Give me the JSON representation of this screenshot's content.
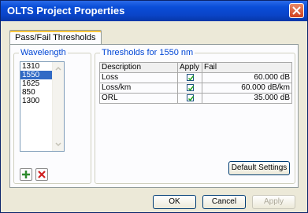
{
  "window": {
    "title": "OLTS Project Properties"
  },
  "tabs": [
    {
      "label": "Pass/Fail Thresholds"
    }
  ],
  "wavelength": {
    "group_title": "Wavelength",
    "items": [
      "1310",
      "1550",
      "1625",
      "850",
      "1300"
    ],
    "selected": "1550"
  },
  "thresholds": {
    "group_title": "Thresholds for 1550 nm",
    "columns": [
      "Description",
      "Apply",
      "Fail"
    ],
    "rows": [
      {
        "description": "Loss",
        "apply": true,
        "fail": "60.000 dB"
      },
      {
        "description": "Loss/km",
        "apply": true,
        "fail": "60.000 dB/km"
      },
      {
        "description": "ORL",
        "apply": true,
        "fail": "35.000 dB"
      }
    ],
    "default_settings_label": "Default Settings"
  },
  "buttons": {
    "ok": "OK",
    "cancel": "Cancel",
    "apply": "Apply"
  },
  "colors": {
    "titlebar": "#0a4ed8",
    "selection": "#316ac5",
    "group_title": "#0046d5",
    "add_icon": "#2e8b2e",
    "remove_icon": "#d02020"
  }
}
